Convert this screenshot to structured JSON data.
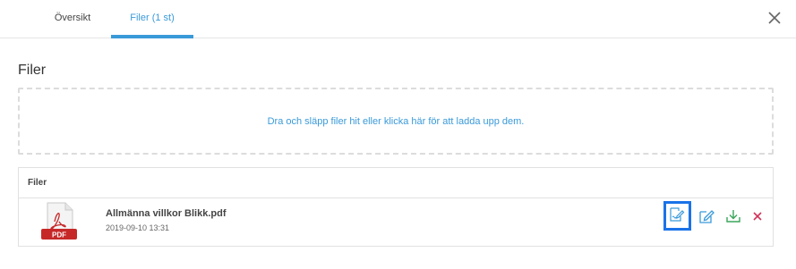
{
  "tabs": [
    {
      "label": "Översikt",
      "active": false
    },
    {
      "label": "Filer (1 st)",
      "active": true
    }
  ],
  "section_title": "Filer",
  "dropzone": {
    "text": "Dra och släpp filer hit eller klicka här för att ladda upp dem."
  },
  "files_panel": {
    "header": "Filer",
    "files": [
      {
        "name": "Allmänna villkor Blikk.pdf",
        "date": "2019-09-10 13:31",
        "type_label": "PDF"
      }
    ]
  },
  "colors": {
    "accent": "#3a9ad9",
    "action_green": "#3aa55a",
    "delete_red": "#d0335a",
    "pdf_red": "#c62828",
    "highlight_blue": "#1a73e8"
  },
  "icons": [
    "close-icon",
    "pdf-file-icon",
    "sign-document-icon",
    "edit-icon",
    "download-icon",
    "delete-icon"
  ]
}
